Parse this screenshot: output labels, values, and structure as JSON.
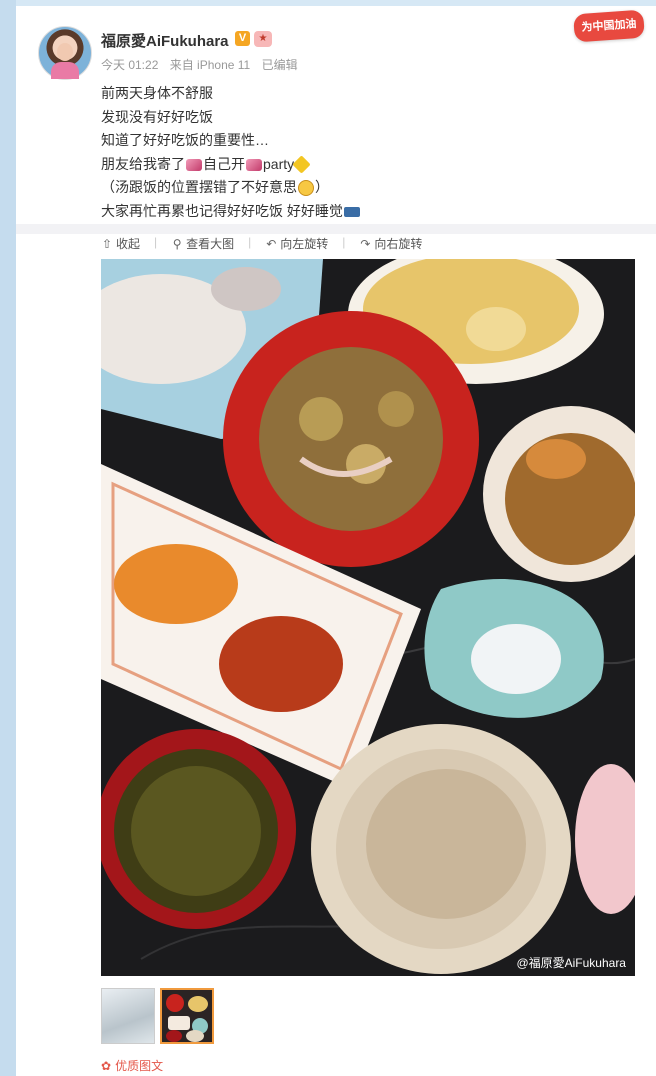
{
  "post": {
    "author": "福原愛AiFukuhara",
    "verified_badge": "V",
    "medal": "🏅",
    "sticker": "为中国加油",
    "meta": {
      "time": "今天 01:22",
      "source": "来自 iPhone 11",
      "edited": "已编辑"
    },
    "lines": {
      "l1": "前两天身体不舒服",
      "l2": "发现没有好好吃饭",
      "l3": "知道了好好吃饭的重要性…",
      "l4a": "朋友给我寄了",
      "l4b": "自己开",
      "l4c": "party",
      "l5": "（汤跟饭的位置摆错了不好意思",
      "l5end": "）",
      "l6": "大家再忙再累也记得好好吃饭 好好睡觉"
    }
  },
  "toolbar": {
    "collapse": "收起",
    "view_large": "查看大图",
    "rotate_left": "向左旋转",
    "rotate_right": "向右旋转"
  },
  "photo": {
    "watermark": "@福原愛AiFukuhara"
  },
  "footer": {
    "quality": "优质图文"
  },
  "icons": [
    "avatar",
    "verified-icon",
    "medal-icon",
    "collapse-icon",
    "zoom-icon",
    "rotate-left-icon",
    "rotate-right-icon",
    "quality-flower-icon"
  ]
}
